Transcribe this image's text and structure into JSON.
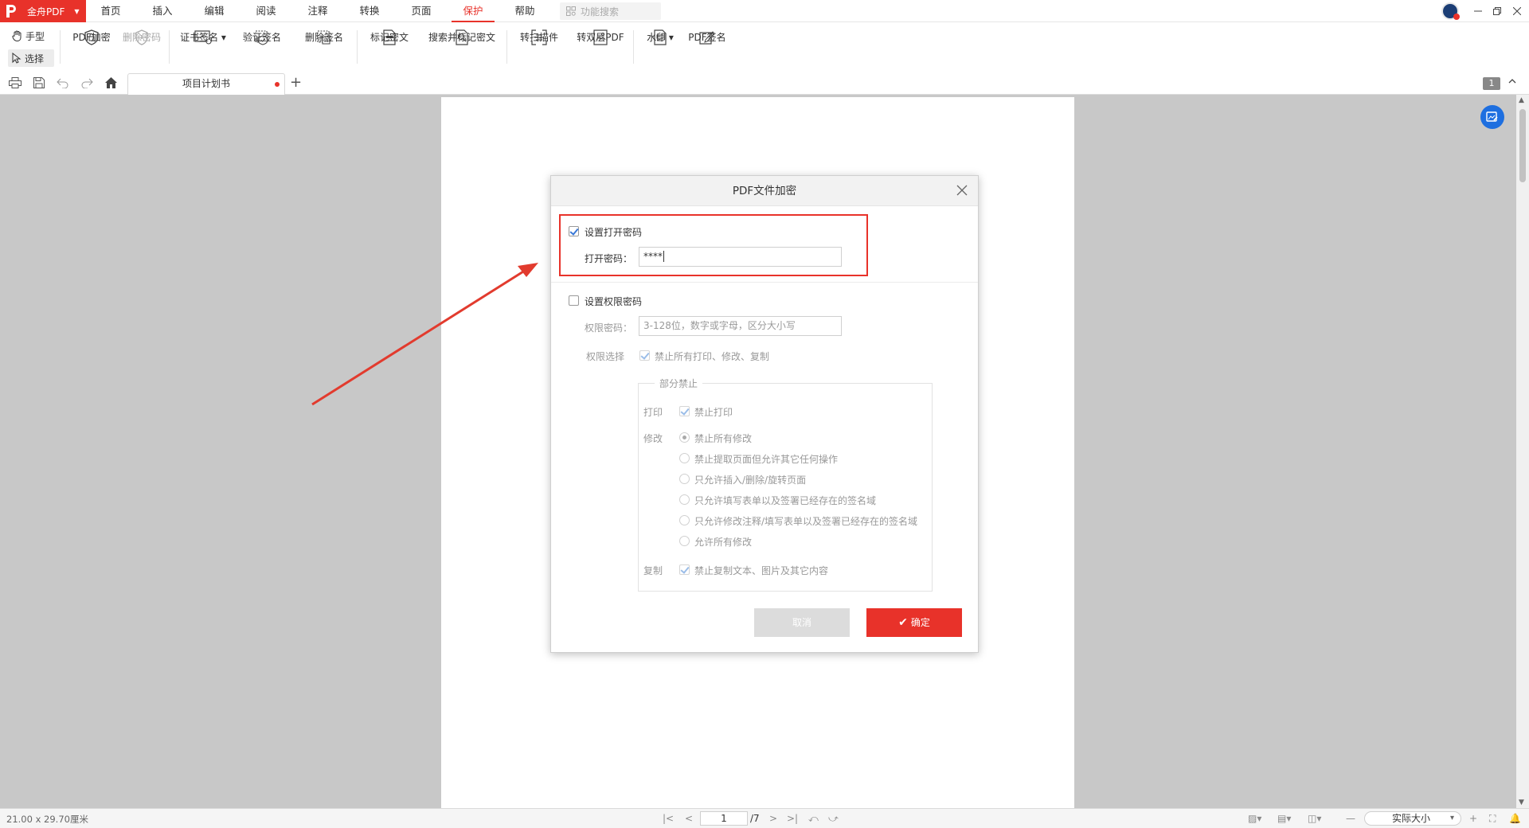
{
  "app": {
    "name": "金舟PDF"
  },
  "menu": {
    "items": [
      {
        "label": "首页"
      },
      {
        "label": "插入"
      },
      {
        "label": "编辑"
      },
      {
        "label": "阅读"
      },
      {
        "label": "注释"
      },
      {
        "label": "转换"
      },
      {
        "label": "页面"
      },
      {
        "label": "保护"
      },
      {
        "label": "帮助"
      }
    ],
    "active": "保护",
    "search_placeholder": "功能搜索"
  },
  "ribbon": {
    "hand": "手型",
    "select": "选择",
    "buttons": {
      "encrypt": "PDF加密",
      "remove_password": "删除密码",
      "cert_sign": "证书签名",
      "verify_sign": "验证签名",
      "delete_sign": "删除签名",
      "mark_secret": "标记密文",
      "search_mark_secret": "搜索并标记密文",
      "to_scan": "转扫描件",
      "to_dual_layer": "转双层PDF",
      "watermark": "水印",
      "pdf_sign": "PDF签名"
    }
  },
  "tabs": {
    "doc_title": "项目计划书",
    "page_badge": "1"
  },
  "dialog": {
    "title": "PDF文件加密",
    "open_password": {
      "checkbox_label": "设置打开密码",
      "field_label": "打开密码：",
      "value": "****"
    },
    "permission_password": {
      "checkbox_label": "设置权限密码",
      "field_label": "权限密码：",
      "placeholder": "3-128位，数字或字母，区分大小写",
      "choice_label": "权限选择",
      "forbid_all_label": "禁止所有打印、修改、复制"
    },
    "partial": {
      "legend": "部分禁止",
      "print_label": "打印",
      "forbid_print": "禁止打印",
      "modify_label": "修改",
      "modify_options": [
        "禁止所有修改",
        "禁止提取页面但允许其它任何操作",
        "只允许插入/删除/旋转页面",
        "只允许填写表单以及签署已经存在的签名域",
        "只允许修改注释/填写表单以及签署已经存在的签名域",
        "允许所有修改"
      ],
      "copy_label": "复制",
      "forbid_copy": "禁止复制文本、图片及其它内容"
    },
    "cancel": "取消",
    "ok": "确定"
  },
  "status": {
    "page_size": "21.00 x 29.70厘米",
    "current_page": "1",
    "total_pages": "/7",
    "zoom": "实际大小"
  },
  "colors": {
    "accent": "#e8322a",
    "check": "#3a78d6"
  }
}
